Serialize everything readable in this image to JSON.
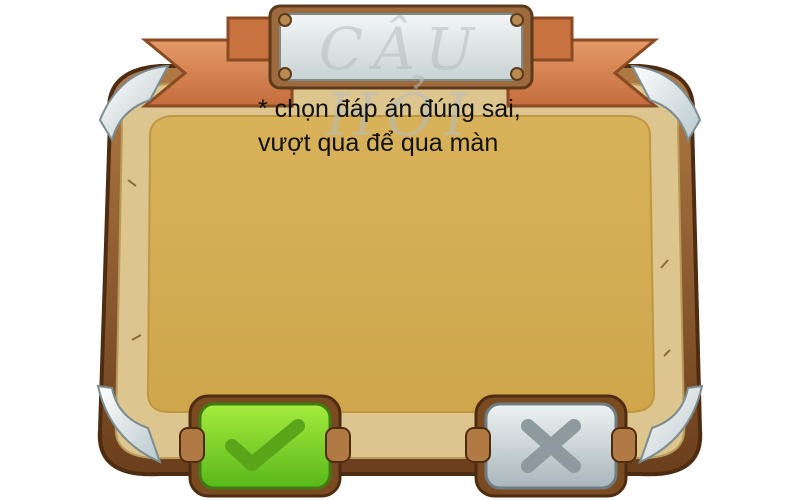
{
  "dialog": {
    "title": "CÂU HỎI",
    "instruction_lines": [
      "* chọn đáp án đúng sai,",
      "vượt qua để qua màn"
    ]
  },
  "buttons": {
    "correct_icon": "check-icon",
    "wrong_icon": "x-icon"
  },
  "colors": {
    "board_frame": "#8a5a2e",
    "board_inner": "#d2aa50",
    "board_rim": "#dcc68e",
    "ribbon": "#d98452",
    "title_plate": "#dfe6e6",
    "correct_button": "#7bd12a",
    "wrong_button": "#c7d1d4",
    "crystal": "#e6eff2"
  }
}
